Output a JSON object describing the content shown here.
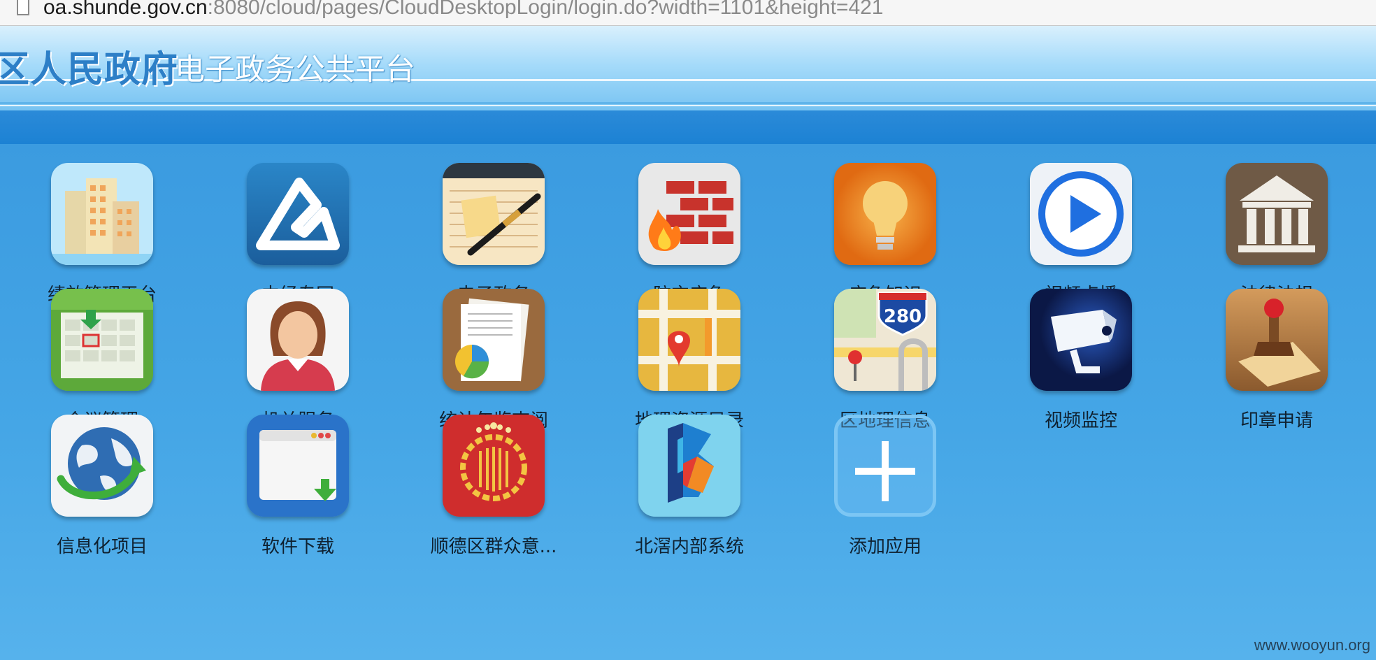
{
  "browser": {
    "url_host": "oa.shunde.gov.cn",
    "url_rest": ":8080/cloud/pages/CloudDesktopLogin/login.do?width=1101&height=421"
  },
  "header": {
    "title": "区人民政府",
    "subtitle": "电子政务公共平台"
  },
  "apps": [
    {
      "label": "绩效管理平台",
      "icon": "buildings-icon"
    },
    {
      "label": "中经专网",
      "icon": "zhongjing-logo-icon"
    },
    {
      "label": "电子政务",
      "icon": "notepad-pen-icon"
    },
    {
      "label": "防灾应急",
      "icon": "firewall-icon"
    },
    {
      "label": "应急知识",
      "icon": "lightbulb-icon"
    },
    {
      "label": "视频点播",
      "icon": "play-icon"
    },
    {
      "label": "法律法规",
      "icon": "courthouse-icon"
    },
    {
      "label": "会议管理",
      "icon": "calendar-icon"
    },
    {
      "label": "机关服务",
      "icon": "person-icon"
    },
    {
      "label": "统计年鉴查阅",
      "icon": "report-pie-icon"
    },
    {
      "label": "地理资源目录",
      "icon": "map-pin-icon"
    },
    {
      "label": "区地理信息",
      "icon": "maps-280-icon"
    },
    {
      "label": "视频监控",
      "icon": "cctv-camera-icon"
    },
    {
      "label": "印章申请",
      "icon": "stamp-icon"
    },
    {
      "label": "信息化项目",
      "icon": "globe-icon"
    },
    {
      "label": "软件下载",
      "icon": "download-window-icon"
    },
    {
      "label": "顺德区群众意...",
      "icon": "emblem-icon"
    },
    {
      "label": "北滘内部系统",
      "icon": "beijiao-logo-icon"
    },
    {
      "label": "添加应用",
      "icon": "plus-icon"
    }
  ],
  "icon_texts": {
    "maps_shield": "280"
  },
  "watermark": "www.wooyun.org"
}
